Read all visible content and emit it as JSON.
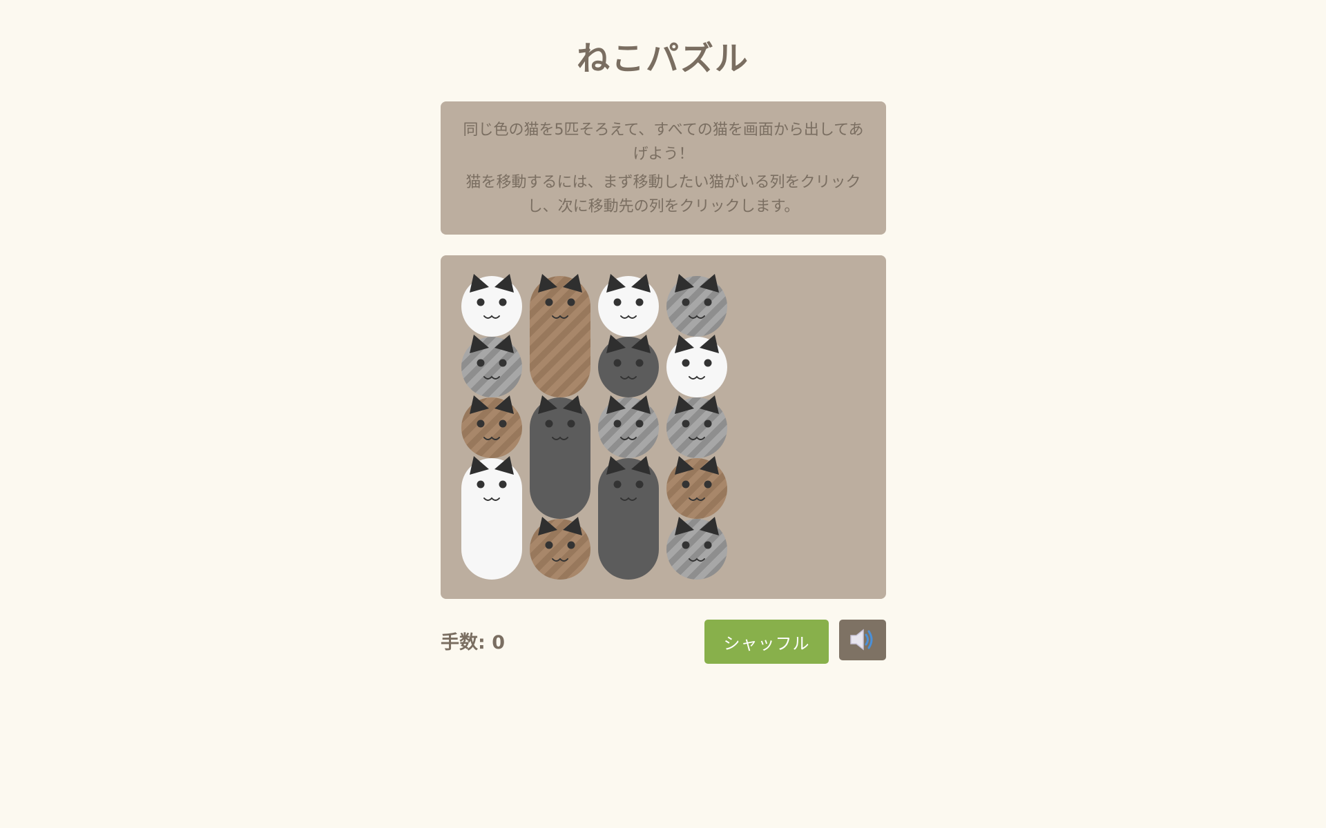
{
  "title": "ねこパズル",
  "instructions": {
    "line1": "同じ色の猫を5匹そろえて、すべての猫を画面から出してあげよう！",
    "line2": "猫を移動するには、まず移動したい猫がいる列をクリックし、次に移動先の列をクリックします。"
  },
  "stats": {
    "moves_label": "手数: ",
    "moves": "0"
  },
  "controls": {
    "shuffle_label": "シャッフル",
    "sound_icon": "speaker-icon"
  },
  "colors": {
    "background": "#fcf9f0",
    "panel": "#bcae9f",
    "text": "#7a6e61",
    "shuffle": "#88b04b",
    "sound_button": "#7e7264",
    "cat_white": "#f7f7f7",
    "cat_brown": "#a8876a",
    "cat_gray": "#8e8e8e",
    "cat_dark": "#5c5c5c"
  },
  "board": {
    "columns": [
      {
        "cats": [
          {
            "color": "white",
            "count": 1
          },
          {
            "color": "gray",
            "count": 1
          },
          {
            "color": "brown",
            "count": 1
          },
          {
            "color": "white",
            "count": 2
          }
        ]
      },
      {
        "cats": [
          {
            "color": "brown",
            "count": 2
          },
          {
            "color": "dark",
            "count": 2
          },
          {
            "color": "brown",
            "count": 1
          }
        ]
      },
      {
        "cats": [
          {
            "color": "white",
            "count": 1
          },
          {
            "color": "dark",
            "count": 1
          },
          {
            "color": "gray",
            "count": 1
          },
          {
            "color": "dark",
            "count": 2
          }
        ]
      },
      {
        "cats": [
          {
            "color": "gray",
            "count": 1
          },
          {
            "color": "white",
            "count": 1
          },
          {
            "color": "gray",
            "count": 1
          },
          {
            "color": "brown",
            "count": 1
          },
          {
            "color": "gray",
            "count": 1
          }
        ]
      }
    ]
  }
}
